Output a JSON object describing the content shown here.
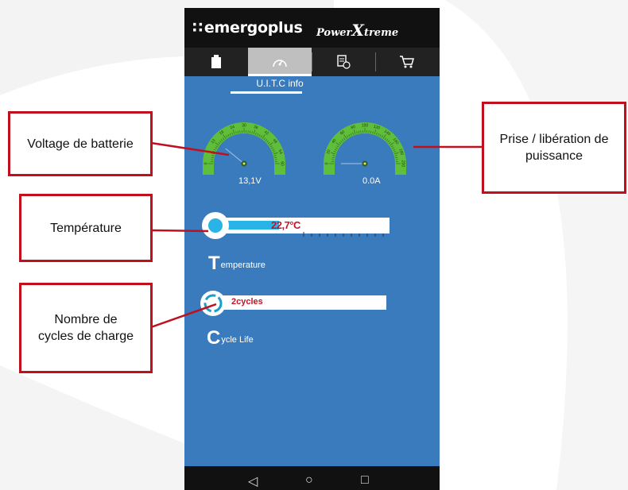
{
  "brand": {
    "logo_mark": "∷",
    "logo_text": "emergoplus",
    "power_text_1": "Power",
    "power_text_x": "X",
    "power_text_2": "treme"
  },
  "tabs": [
    {
      "icon": "battery-icon"
    },
    {
      "icon": "speedometer-icon",
      "active": true
    },
    {
      "icon": "document-info-icon"
    },
    {
      "icon": "cart-icon"
    }
  ],
  "subtitle": "U.I.T.C info",
  "voltage_gauge": {
    "ticks": [
      "0",
      "6",
      "12",
      "18",
      "24",
      "30",
      "36",
      "42",
      "48",
      "54",
      "60"
    ],
    "value": "13,1V",
    "reading": 13.1,
    "max": 60
  },
  "current_gauge": {
    "ticks": [
      "0",
      "20",
      "40",
      "60",
      "80",
      "100",
      "120",
      "140",
      "160",
      "180",
      "200"
    ],
    "value": "0.0A",
    "reading": 0,
    "max": 200
  },
  "temperature": {
    "value": "22,7°C",
    "fill_fraction": 0.4,
    "label_big": "T",
    "label_rest": "emperature"
  },
  "cycle_life": {
    "value": "2cycles",
    "label_big": "C",
    "label_rest": "ycle Life"
  },
  "nav": {
    "back": "◁",
    "home": "○",
    "recent": "□"
  },
  "callouts": {
    "voltage": "Voltage de batterie",
    "power": "Prise / libération de puissance",
    "temperature": "Température",
    "cycles": "Nombre de cycles de charge"
  },
  "colors": {
    "screen_bg": "#3a7bbd",
    "gauge_green": "#5fbf3a",
    "accent_blue": "#28b4e6",
    "callout_red": "#c0101e",
    "value_red": "#c0152a"
  }
}
